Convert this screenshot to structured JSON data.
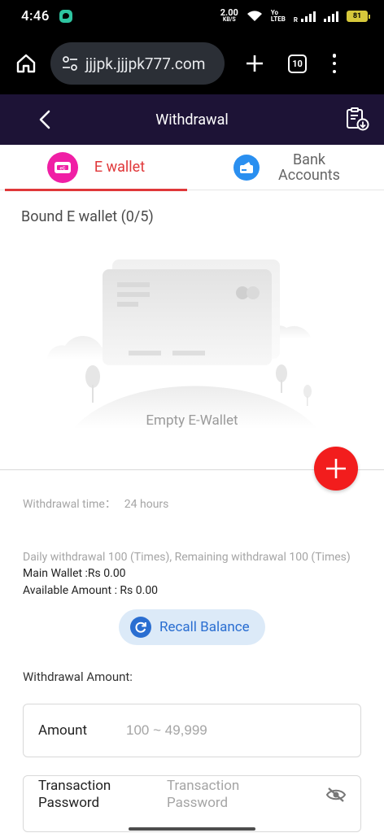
{
  "status_bar": {
    "time": "4:46",
    "net_speed_value": "2.00",
    "net_speed_unit": "KB/S",
    "volte_top": "Yo",
    "volte_bottom": "LTEB",
    "signal_r": "R",
    "battery": "81"
  },
  "browser": {
    "url": "jjjpk.jjjpk777.com",
    "tab_count": "10"
  },
  "header": {
    "title": "Withdrawal"
  },
  "tabs": [
    {
      "label": "E wallet",
      "active": true
    },
    {
      "label": "Bank Accounts",
      "active": false
    }
  ],
  "wallet": {
    "bound_title": "Bound E wallet (0/5)",
    "empty_label": "Empty E-Wallet"
  },
  "info": {
    "withdrawal_time_label": "Withdrawal time：",
    "withdrawal_time_value": "24 hours",
    "daily_note": "Daily withdrawal 100 (Times), Remaining withdrawal 100 (Times)",
    "main_wallet": "Main Wallet :Rs 0.00",
    "available_amount": "Available Amount : Rs 0.00"
  },
  "recall_button": {
    "label": "Recall Balance"
  },
  "form": {
    "amount_section_label": "Withdrawal Amount:",
    "amount_label": "Amount",
    "amount_placeholder": "100 ~ 49,999",
    "password_label": "Transaction Password",
    "password_placeholder": "Transaction Password"
  },
  "colors": {
    "header_bg": "#1d1336",
    "accent_red": "#e0383a",
    "add_button": "#f21d1d",
    "recall_bg": "#dceaf8",
    "recall_text": "#2a6ed1",
    "ewallet_icon": "#f01fa5",
    "bank_icon": "#2a8ff0"
  }
}
